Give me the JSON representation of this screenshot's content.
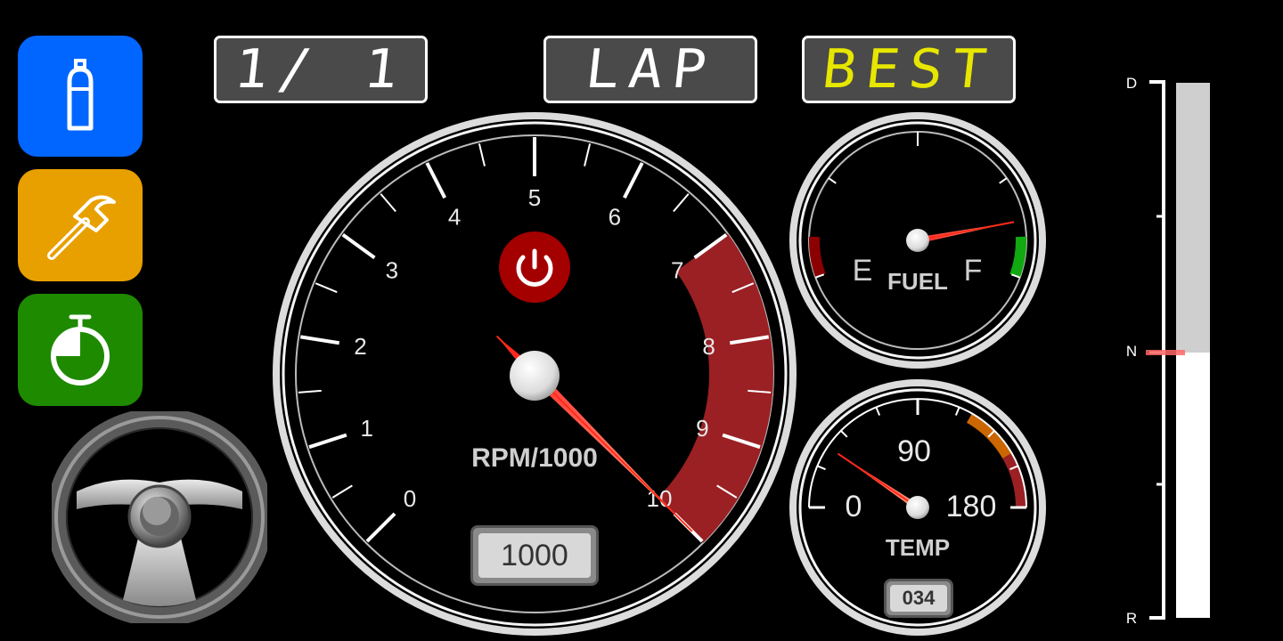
{
  "sidebar": {
    "buttons": [
      {
        "id": "nitro",
        "icon": "gas-cylinder-icon",
        "color": "#0066ff"
      },
      {
        "id": "repair",
        "icon": "hammer-icon",
        "color": "#e8a000"
      },
      {
        "id": "timer",
        "icon": "stopwatch-icon",
        "color": "#1e8a00"
      }
    ],
    "steering_icon": "steering-wheel-icon"
  },
  "displays": {
    "position": "1/ 1",
    "lap": "LAP",
    "best": "BEST",
    "position_color": "#ffffff",
    "lap_color": "#ffffff",
    "best_color": "#e6e600"
  },
  "tachometer": {
    "label": "RPM/1000",
    "ticks": [
      "0",
      "1",
      "2",
      "3",
      "4",
      "5",
      "6",
      "7",
      "8",
      "9",
      "10"
    ],
    "redline_start": 7,
    "needle_value": 10.0,
    "odometer": "1000",
    "power_icon": "power-icon"
  },
  "fuel_gauge": {
    "label": "FUEL",
    "empty_label": "E",
    "full_label": "F",
    "level": 0.86
  },
  "temp_gauge": {
    "label": "TEMP",
    "ticks": [
      "0",
      "90",
      "180"
    ],
    "value": 34,
    "readout": "034"
  },
  "gear_bar": {
    "labels": {
      "top": "D",
      "middle": "N",
      "bottom": "R"
    },
    "current": "N"
  },
  "colors": {
    "redline": "#9a2024",
    "fuel_empty": "#8b0000",
    "fuel_full": "#11a811",
    "temp_warn": "#cc6600",
    "needle": "#e8201a"
  }
}
